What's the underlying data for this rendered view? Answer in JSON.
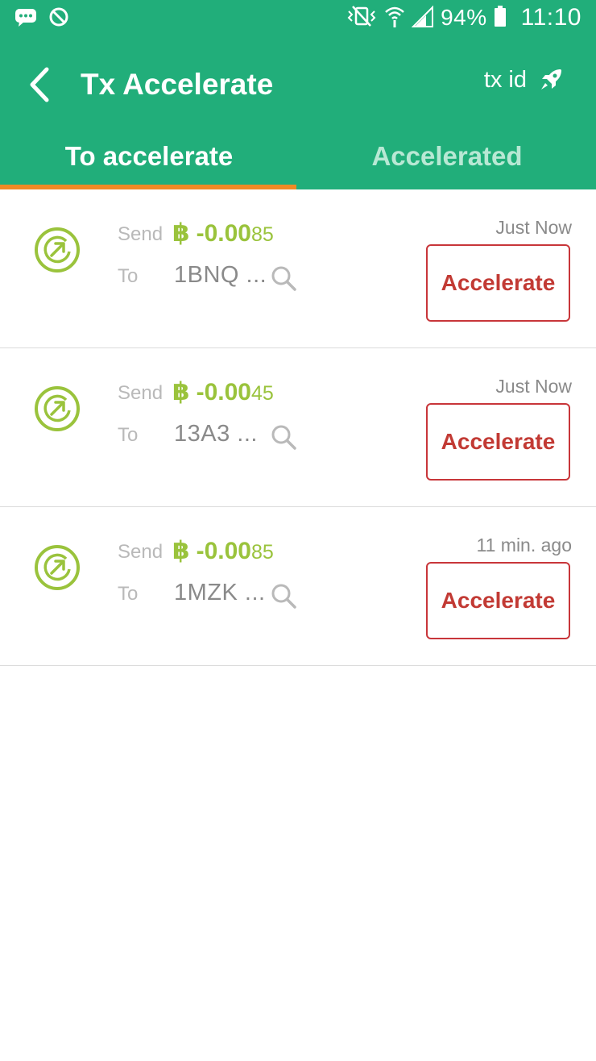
{
  "status_bar": {
    "battery": "94%",
    "time": "11:10",
    "icons": [
      "message-icon",
      "blocked-icon",
      "vibrate-icon",
      "wifi-icon",
      "signal-icon",
      "battery-icon"
    ]
  },
  "toolbar": {
    "title": "Tx Accelerate",
    "txid_label": "tx id",
    "back_icon": "chevron-left-icon",
    "txid_icon": "rocket-icon"
  },
  "tabs": [
    {
      "label": "To accelerate",
      "active": true
    },
    {
      "label": "Accelerated",
      "active": false
    }
  ],
  "colors": {
    "header": "#21ae7a",
    "tab_indicator": "#f08a24",
    "amount": "#9ac33c",
    "accelerate_border": "#c8363a",
    "accelerate_text": "#c23a34"
  },
  "transactions": [
    {
      "send_label": "Send",
      "btc_symbol": "฿",
      "amount_main": "-0.00",
      "amount_small": "85",
      "to_label": "To",
      "address": "1BNQ ...",
      "time": "Just Now",
      "action_label": "Accelerate"
    },
    {
      "send_label": "Send",
      "btc_symbol": "฿",
      "amount_main": "-0.00",
      "amount_small": "45",
      "to_label": "To",
      "address": "13A3 ...",
      "time": "Just Now",
      "action_label": "Accelerate"
    },
    {
      "send_label": "Send",
      "btc_symbol": "฿",
      "amount_main": "-0.00",
      "amount_small": "85",
      "to_label": "To",
      "address": "1MZK ...",
      "time": "11 min. ago",
      "action_label": "Accelerate"
    }
  ]
}
